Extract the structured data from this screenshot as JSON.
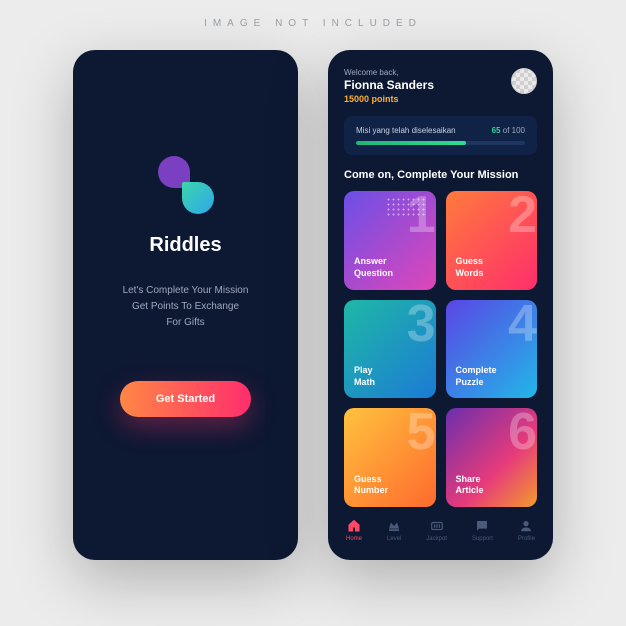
{
  "watermark": "IMAGE NOT INCLUDED",
  "splash": {
    "app_name": "Riddles",
    "tagline_l1": "Let's Complete Your Mission",
    "tagline_l2": "Get Points To Exchange",
    "tagline_l3": "For Gifts",
    "cta": "Get Started"
  },
  "home": {
    "welcome": "Welcome back,",
    "username": "Fionna Sanders",
    "points": "15000 points",
    "progress": {
      "label": "Misi yang telah diselesaikan",
      "done": "65",
      "of": " of ",
      "total": "100",
      "percent": 65
    },
    "section_title": "Come on, Complete Your Mission",
    "cards": [
      {
        "label_l1": "Answer",
        "label_l2": "Question",
        "num": "1"
      },
      {
        "label_l1": "Guess",
        "label_l2": "Words",
        "num": "2"
      },
      {
        "label_l1": "Play",
        "label_l2": "Math",
        "num": "3"
      },
      {
        "label_l1": "Complete",
        "label_l2": "Puzzle",
        "num": "4"
      },
      {
        "label_l1": "Guess",
        "label_l2": "Number",
        "num": "5"
      },
      {
        "label_l1": "Share",
        "label_l2": "Article",
        "num": "6"
      }
    ],
    "nav": [
      {
        "label": "Home"
      },
      {
        "label": "Level"
      },
      {
        "label": "Jackpot"
      },
      {
        "label": "Support"
      },
      {
        "label": "Profile"
      }
    ]
  }
}
